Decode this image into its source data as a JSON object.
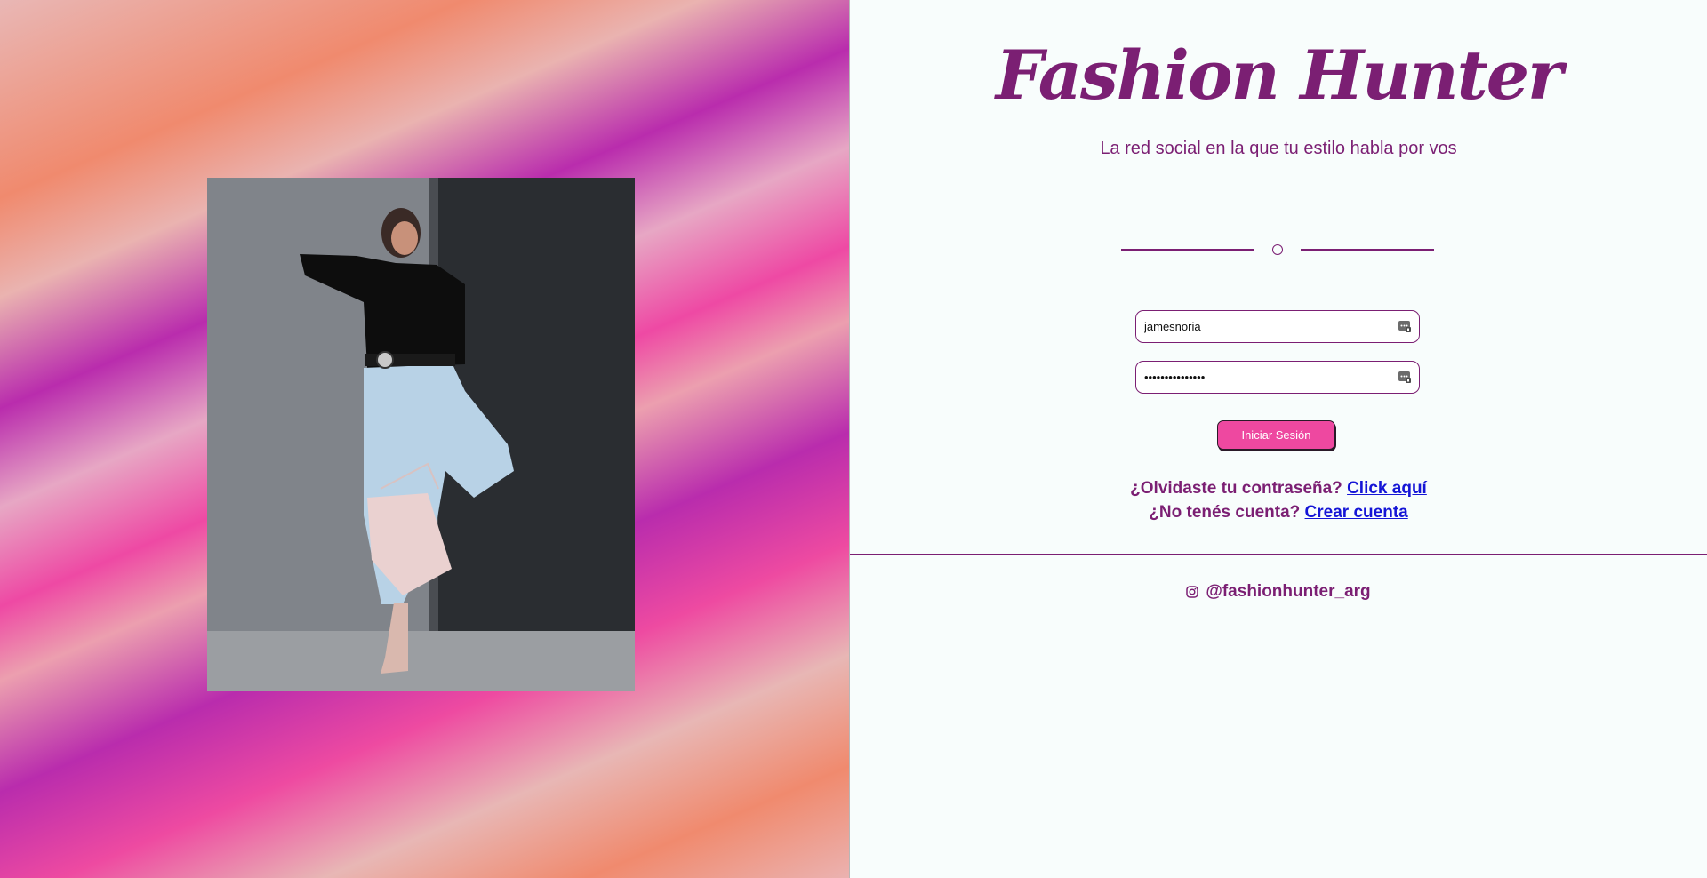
{
  "brand": {
    "title": "Fashion Hunter",
    "tagline": "La red social en la que tu estilo habla por vos"
  },
  "hero_image": {
    "icon": "fashion-model-photo"
  },
  "login_form": {
    "username_value": "jamesnoria",
    "password_value": "thisisapassword",
    "submit_label": "Iniciar Sesión",
    "field_icon": "password-manager-key-icon"
  },
  "links": {
    "forgot_prompt": "¿Olvidaste tu contraseña?",
    "forgot_link": "Click aquí",
    "signup_prompt": "¿No tenés cuenta?",
    "signup_link": "Crear cuenta"
  },
  "social": {
    "icon": "instagram-icon",
    "handle": "@fashionhunter_arg"
  },
  "colors": {
    "brand_purple": "#7b1f73",
    "button_pink": "#ee48a0",
    "link_blue": "#1515d6",
    "page_bg": "#f8fdfc"
  }
}
